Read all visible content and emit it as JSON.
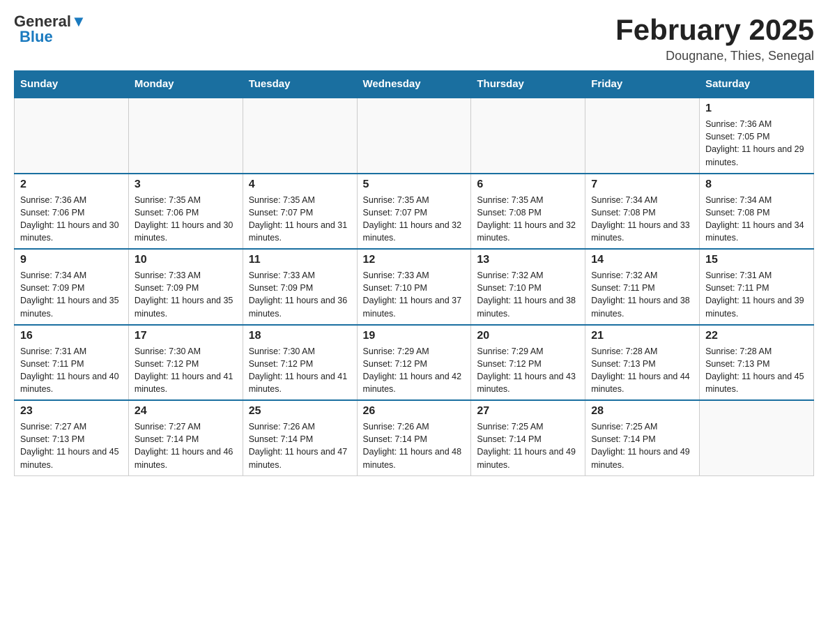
{
  "header": {
    "logo_general": "General",
    "logo_blue": "Blue",
    "title": "February 2025",
    "subtitle": "Dougnane, Thies, Senegal"
  },
  "days_of_week": [
    "Sunday",
    "Monday",
    "Tuesday",
    "Wednesday",
    "Thursday",
    "Friday",
    "Saturday"
  ],
  "weeks": [
    [
      {
        "day": "",
        "info": ""
      },
      {
        "day": "",
        "info": ""
      },
      {
        "day": "",
        "info": ""
      },
      {
        "day": "",
        "info": ""
      },
      {
        "day": "",
        "info": ""
      },
      {
        "day": "",
        "info": ""
      },
      {
        "day": "1",
        "info": "Sunrise: 7:36 AM\nSunset: 7:05 PM\nDaylight: 11 hours and 29 minutes."
      }
    ],
    [
      {
        "day": "2",
        "info": "Sunrise: 7:36 AM\nSunset: 7:06 PM\nDaylight: 11 hours and 30 minutes."
      },
      {
        "day": "3",
        "info": "Sunrise: 7:35 AM\nSunset: 7:06 PM\nDaylight: 11 hours and 30 minutes."
      },
      {
        "day": "4",
        "info": "Sunrise: 7:35 AM\nSunset: 7:07 PM\nDaylight: 11 hours and 31 minutes."
      },
      {
        "day": "5",
        "info": "Sunrise: 7:35 AM\nSunset: 7:07 PM\nDaylight: 11 hours and 32 minutes."
      },
      {
        "day": "6",
        "info": "Sunrise: 7:35 AM\nSunset: 7:08 PM\nDaylight: 11 hours and 32 minutes."
      },
      {
        "day": "7",
        "info": "Sunrise: 7:34 AM\nSunset: 7:08 PM\nDaylight: 11 hours and 33 minutes."
      },
      {
        "day": "8",
        "info": "Sunrise: 7:34 AM\nSunset: 7:08 PM\nDaylight: 11 hours and 34 minutes."
      }
    ],
    [
      {
        "day": "9",
        "info": "Sunrise: 7:34 AM\nSunset: 7:09 PM\nDaylight: 11 hours and 35 minutes."
      },
      {
        "day": "10",
        "info": "Sunrise: 7:33 AM\nSunset: 7:09 PM\nDaylight: 11 hours and 35 minutes."
      },
      {
        "day": "11",
        "info": "Sunrise: 7:33 AM\nSunset: 7:09 PM\nDaylight: 11 hours and 36 minutes."
      },
      {
        "day": "12",
        "info": "Sunrise: 7:33 AM\nSunset: 7:10 PM\nDaylight: 11 hours and 37 minutes."
      },
      {
        "day": "13",
        "info": "Sunrise: 7:32 AM\nSunset: 7:10 PM\nDaylight: 11 hours and 38 minutes."
      },
      {
        "day": "14",
        "info": "Sunrise: 7:32 AM\nSunset: 7:11 PM\nDaylight: 11 hours and 38 minutes."
      },
      {
        "day": "15",
        "info": "Sunrise: 7:31 AM\nSunset: 7:11 PM\nDaylight: 11 hours and 39 minutes."
      }
    ],
    [
      {
        "day": "16",
        "info": "Sunrise: 7:31 AM\nSunset: 7:11 PM\nDaylight: 11 hours and 40 minutes."
      },
      {
        "day": "17",
        "info": "Sunrise: 7:30 AM\nSunset: 7:12 PM\nDaylight: 11 hours and 41 minutes."
      },
      {
        "day": "18",
        "info": "Sunrise: 7:30 AM\nSunset: 7:12 PM\nDaylight: 11 hours and 41 minutes."
      },
      {
        "day": "19",
        "info": "Sunrise: 7:29 AM\nSunset: 7:12 PM\nDaylight: 11 hours and 42 minutes."
      },
      {
        "day": "20",
        "info": "Sunrise: 7:29 AM\nSunset: 7:12 PM\nDaylight: 11 hours and 43 minutes."
      },
      {
        "day": "21",
        "info": "Sunrise: 7:28 AM\nSunset: 7:13 PM\nDaylight: 11 hours and 44 minutes."
      },
      {
        "day": "22",
        "info": "Sunrise: 7:28 AM\nSunset: 7:13 PM\nDaylight: 11 hours and 45 minutes."
      }
    ],
    [
      {
        "day": "23",
        "info": "Sunrise: 7:27 AM\nSunset: 7:13 PM\nDaylight: 11 hours and 45 minutes."
      },
      {
        "day": "24",
        "info": "Sunrise: 7:27 AM\nSunset: 7:14 PM\nDaylight: 11 hours and 46 minutes."
      },
      {
        "day": "25",
        "info": "Sunrise: 7:26 AM\nSunset: 7:14 PM\nDaylight: 11 hours and 47 minutes."
      },
      {
        "day": "26",
        "info": "Sunrise: 7:26 AM\nSunset: 7:14 PM\nDaylight: 11 hours and 48 minutes."
      },
      {
        "day": "27",
        "info": "Sunrise: 7:25 AM\nSunset: 7:14 PM\nDaylight: 11 hours and 49 minutes."
      },
      {
        "day": "28",
        "info": "Sunrise: 7:25 AM\nSunset: 7:14 PM\nDaylight: 11 hours and 49 minutes."
      },
      {
        "day": "",
        "info": ""
      }
    ]
  ],
  "colors": {
    "header_bg": "#1a6fa0",
    "header_text": "#ffffff",
    "border": "#cccccc"
  }
}
